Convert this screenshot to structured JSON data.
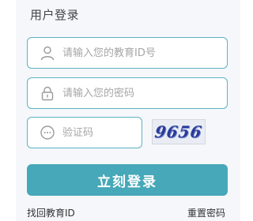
{
  "login": {
    "title": "用户登录",
    "id_placeholder": "请输入您的教育ID号",
    "password_placeholder": "请输入您的密码",
    "captcha_placeholder": "验证码",
    "captcha_code": "9656",
    "submit_label": "立刻登录",
    "forgot_id_link": "找回教育ID",
    "reset_password_link": "重置密码"
  },
  "icons": {
    "id_field": "user-icon",
    "password_field": "lock-icon",
    "captcha_field": "chat-bubble-icon"
  },
  "colors": {
    "accent": "#46a8b8",
    "input_border": "#5cb3c0",
    "panel_bg": "#f5f7fb",
    "placeholder": "#a6a6a6"
  }
}
